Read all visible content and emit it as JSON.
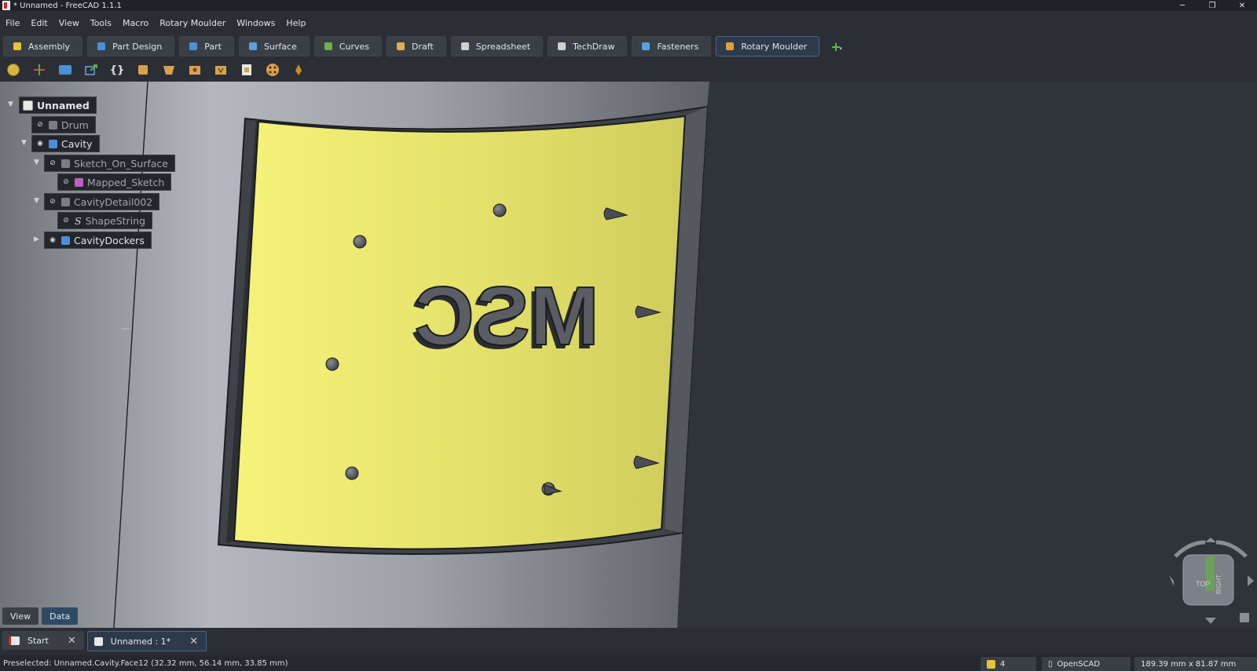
{
  "window": {
    "title": "* Unnamed - FreeCAD 1.1.1",
    "controls": [
      "─",
      "❐",
      "✕"
    ]
  },
  "menu": [
    "File",
    "Edit",
    "View",
    "Tools",
    "Macro",
    "Rotary Moulder",
    "Windows",
    "Help"
  ],
  "workbenches": [
    {
      "label": "Assembly",
      "color": "#e8c23a"
    },
    {
      "label": "Part Design",
      "color": "#4a90d9"
    },
    {
      "label": "Part",
      "color": "#4a90d9"
    },
    {
      "label": "Surface",
      "color": "#5aa0e0"
    },
    {
      "label": "Curves",
      "color": "#6ab04c"
    },
    {
      "label": "Draft",
      "color": "#e0b050"
    },
    {
      "label": "Spreadsheet",
      "color": "#d0d0d0"
    },
    {
      "label": "TechDraw",
      "color": "#d0d0d0"
    },
    {
      "label": "Fasteners",
      "color": "#5aa0e0"
    },
    {
      "label": "Rotary Moulder",
      "color": "#e0a040",
      "active": true
    }
  ],
  "toolbar": [
    "new-doc-icon",
    "axis-icon",
    "folder-icon",
    "export-icon",
    "braces-icon",
    "box-icon",
    "cavity-icon",
    "cavity2-icon",
    "cavity3-icon",
    "mold-icon",
    "dots-icon",
    "pin-icon"
  ],
  "tree": {
    "root": "Unnamed",
    "items": [
      {
        "label": "Drum",
        "dim": true
      },
      {
        "label": "Cavity"
      },
      {
        "label": "Sketch_On_Surface",
        "dim": true
      },
      {
        "label": "Mapped_Sketch",
        "dim": true
      },
      {
        "label": "CavityDetail002",
        "dim": true
      },
      {
        "label": "ShapeString",
        "dim": true
      },
      {
        "label": "CavityDockers"
      }
    ]
  },
  "model": {
    "emboss_text": "MSC",
    "panel_color": "#e4e16a"
  },
  "panel_tabs": [
    "View",
    "Data"
  ],
  "doc_tabs": [
    "Start",
    "Unnamed : 1*"
  ],
  "navcube": {
    "top": "TOP",
    "right": "RIGHT"
  },
  "status": {
    "message": "Preselected: Unnamed.Cavity.Face12 (32.32 mm, 56.14 mm, 33.85 mm)",
    "count": "4",
    "nav_style": "OpenSCAD",
    "dimensions": "189.39 mm x 81.87 mm"
  }
}
